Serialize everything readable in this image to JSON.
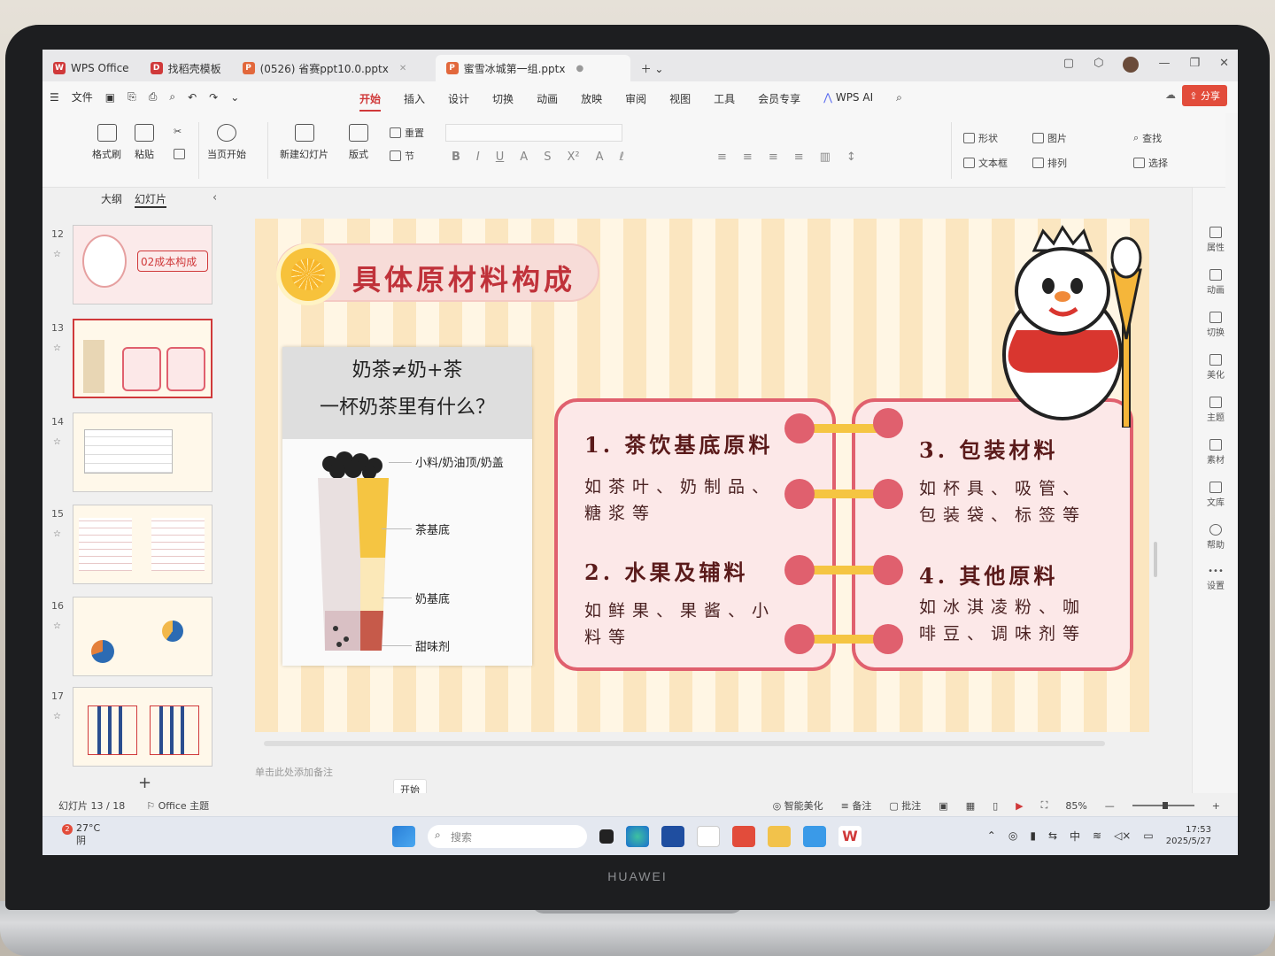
{
  "tabs": [
    {
      "label": "WPS Office",
      "color": "#d0393a",
      "icon": "wps-logo-icon"
    },
    {
      "label": "找稻壳模板",
      "color": "#d0393a",
      "icon": "docer-icon"
    },
    {
      "label": "(0526) 省赛ppt10.0.pptx",
      "color": "#e2683c",
      "icon": "ppt-icon"
    },
    {
      "label": "蜜雪冰城第一组.pptx",
      "color": "#e2683c",
      "icon": "ppt-icon"
    }
  ],
  "menu": {
    "file": "文件",
    "tabs": [
      "开始",
      "插入",
      "设计",
      "切换",
      "动画",
      "放映",
      "审阅",
      "视图",
      "工具",
      "会员专享"
    ],
    "wps_ai": "WPS AI",
    "share": "分享"
  },
  "ribbon": {
    "format_painter": "格式刷",
    "paste": "粘贴",
    "from_current": "当页开始",
    "new_slide": "新建幻灯片",
    "layout": "版式",
    "reset": "重置",
    "section": "节",
    "shape": "形状",
    "picture": "图片",
    "find": "查找",
    "textbox": "文本框",
    "arrange": "排列",
    "select": "选择"
  },
  "left_pane": {
    "outline": "大纲",
    "slides": "幻灯片",
    "thumbs": [
      {
        "num": "12",
        "text": "02成本构成"
      },
      {
        "num": "13",
        "text": ""
      },
      {
        "num": "14",
        "text": ""
      },
      {
        "num": "15",
        "text": ""
      },
      {
        "num": "16",
        "text": ""
      },
      {
        "num": "17",
        "text": ""
      }
    ]
  },
  "slide": {
    "title": "具体原材料构成",
    "card_line1": "奶茶≠奶+茶",
    "card_line2": "一杯奶茶里有什么？",
    "cup_labels": [
      "小料/奶油顶/奶盖",
      "茶基底",
      "奶基底",
      "甜味剂"
    ],
    "items": [
      {
        "title": "1. 茶饮基底原料",
        "body": "如茶叶、奶制品、糖浆等"
      },
      {
        "title": "2. 水果及辅料",
        "body": "如鲜果、果酱、小料等"
      },
      {
        "title": "3. 包装材料",
        "body": "如杯具、吸管、包装袋、标签等"
      },
      {
        "title": "4. 其他原料",
        "body": "如冰淇凌粉、咖啡豆、调味剂等"
      }
    ]
  },
  "notes_placeholder": "单击此处添加备注",
  "right_bar": [
    "属性",
    "动画",
    "切换",
    "美化",
    "主题",
    "素材",
    "文库",
    "帮助",
    "设置"
  ],
  "status": {
    "slide_info": "幻灯片 13 / 18",
    "theme": "Office 主题",
    "tooltip": "开始",
    "smart": "智能美化",
    "notes": "备注",
    "comments": "批注",
    "zoom": "85%"
  },
  "taskbar": {
    "weather_temp": "27°C",
    "weather_desc": "阴",
    "weather_badge": "2",
    "search": "搜索",
    "lang": "中",
    "time": "17:53",
    "date": "2025/5/27"
  },
  "device_brand": "HUAWEI",
  "colors": {
    "accent": "#d0393a",
    "panel_border": "#e0606e",
    "title_red": "#c0323a"
  }
}
